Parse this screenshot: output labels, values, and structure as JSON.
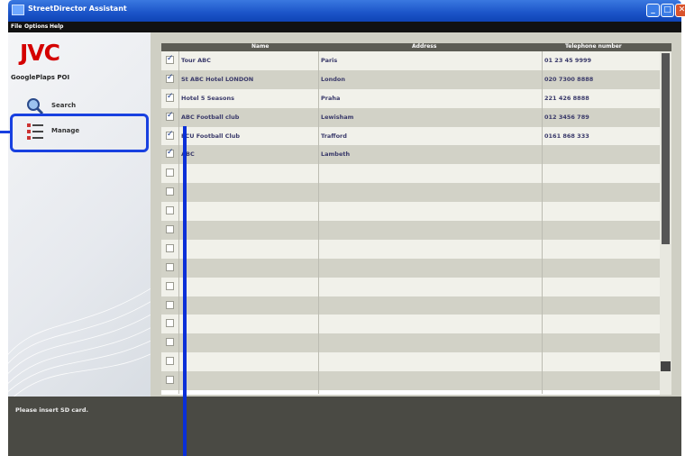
{
  "window": {
    "title": "StreetDirector Assistant",
    "controls": [
      "minimize",
      "maximize",
      "close"
    ]
  },
  "menu": {
    "items": [
      "File",
      "Options",
      "Help"
    ]
  },
  "sidebar": {
    "logo": "JVC",
    "subtitle": "GooglePlaps POI",
    "nav": [
      {
        "label": "Search",
        "icon": "search-icon"
      },
      {
        "label": "Manage",
        "icon": "list-icon"
      }
    ]
  },
  "table": {
    "columns": [
      "Name",
      "Address",
      "Telephone number"
    ],
    "rows": [
      {
        "checked": true,
        "name": "Tour ABC",
        "address": "Paris",
        "tel": "01 23 45 9999"
      },
      {
        "checked": true,
        "name": "St ABC Hotel LONDON",
        "address": "London",
        "tel": "020 7300 8888"
      },
      {
        "checked": true,
        "name": "Hotel 5 Seasons",
        "address": "Praha",
        "tel": "221 426 8888"
      },
      {
        "checked": true,
        "name": "ABC Football club",
        "address": "Lewisham",
        "tel": "012 3456 789"
      },
      {
        "checked": true,
        "name": "FCU Football Club",
        "address": "Trafford",
        "tel": "0161 868 333"
      },
      {
        "checked": true,
        "name": "ABC",
        "address": "Lambeth",
        "tel": ""
      },
      {
        "checked": false,
        "name": "",
        "address": "",
        "tel": ""
      },
      {
        "checked": false,
        "name": "",
        "address": "",
        "tel": ""
      },
      {
        "checked": false,
        "name": "",
        "address": "",
        "tel": ""
      },
      {
        "checked": false,
        "name": "",
        "address": "",
        "tel": ""
      },
      {
        "checked": false,
        "name": "",
        "address": "",
        "tel": ""
      },
      {
        "checked": false,
        "name": "",
        "address": "",
        "tel": ""
      },
      {
        "checked": false,
        "name": "",
        "address": "",
        "tel": ""
      },
      {
        "checked": false,
        "name": "",
        "address": "",
        "tel": ""
      },
      {
        "checked": false,
        "name": "",
        "address": "",
        "tel": ""
      },
      {
        "checked": false,
        "name": "",
        "address": "",
        "tel": ""
      },
      {
        "checked": false,
        "name": "",
        "address": "",
        "tel": ""
      },
      {
        "checked": false,
        "name": "",
        "address": "",
        "tel": ""
      }
    ]
  },
  "actions": [
    {
      "icon": "save-icon",
      "color": "#3a3a3a"
    },
    {
      "icon": "edit-icon",
      "color": "#3a3a3a"
    },
    {
      "icon": "delete-icon",
      "color": "#c0282a"
    },
    {
      "icon": "delete-all-icon",
      "color": "#c0282a"
    }
  ],
  "status": {
    "message": "Please insert SD card."
  },
  "colors": {
    "accent": "#1840e0",
    "brand": "#d40000"
  }
}
